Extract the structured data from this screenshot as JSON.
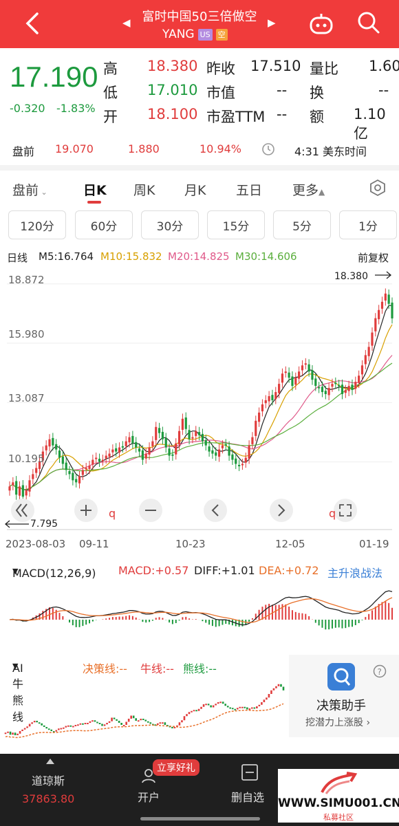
{
  "header": {
    "title": "富时中国50三倍做空",
    "symbol": "YANG",
    "badge_us": "US",
    "badge_short": "空"
  },
  "quote": {
    "price": "17.190",
    "change": "-0.320",
    "change_pct": "-1.83%",
    "high_label": "高",
    "high": "18.380",
    "low_label": "低",
    "low": "17.010",
    "open_label": "开",
    "open": "18.100",
    "prev_close_label": "昨收",
    "prev_close": "17.510",
    "mcap_label": "市值",
    "mcap": "--",
    "pe_label": "市盈TTM",
    "pe": "--",
    "vol_ratio_label": "量比",
    "vol_ratio": "1.60",
    "turnover_label": "换",
    "turnover": "--",
    "amount_label": "额",
    "amount": "1.10亿"
  },
  "premarket": {
    "label": "盘前",
    "price": "19.070",
    "change": "1.880",
    "change_pct": "10.94%",
    "time": "4:31 美东时间"
  },
  "tabs": {
    "premarket": "盘前",
    "day": "日K",
    "week": "周K",
    "month": "月K",
    "five_day": "五日",
    "more": "更多"
  },
  "periods": [
    "120分",
    "60分",
    "30分",
    "15分",
    "5分",
    "1分"
  ],
  "ma": {
    "type": "日线",
    "m5": "M5:16.764",
    "m10": "M10:15.832",
    "m20": "M20:14.825",
    "m30": "M30:14.606",
    "adjust": "前复权"
  },
  "chart_data": {
    "type": "candlestick",
    "title": "",
    "y_ticks": [
      "18.872",
      "15.980",
      "13.087",
      "10.195"
    ],
    "x_ticks": [
      "2023-08-03",
      "09-11",
      "10-23",
      "12-05",
      "01-19"
    ],
    "ylim": [
      7.3,
      19.3
    ],
    "high_marker": "18.380",
    "low_marker": "7.795",
    "closes": [
      9.0,
      9.2,
      8.6,
      9.0,
      8.5,
      8.8,
      9.3,
      9.6,
      9.9,
      10.2,
      10.7,
      11.0,
      11.3,
      11.0,
      10.8,
      10.4,
      10.1,
      9.8,
      9.6,
      9.3,
      9.2,
      9.5,
      9.8,
      9.9,
      10.0,
      10.3,
      10.4,
      10.2,
      10.3,
      10.5,
      10.6,
      10.8,
      10.7,
      10.9,
      10.9,
      11.2,
      11.4,
      11.1,
      10.9,
      10.7,
      10.3,
      10.6,
      10.9,
      11.2,
      11.9,
      11.6,
      11.3,
      10.9,
      10.5,
      10.5,
      11.1,
      11.7,
      12.3,
      11.8,
      11.3,
      11.4,
      11.7,
      11.5,
      11.2,
      11.0,
      10.7,
      10.6,
      10.5,
      10.8,
      11.0,
      11.0,
      10.5,
      10.3,
      10.1,
      10.0,
      10.1,
      10.4,
      11.0,
      11.4,
      12.2,
      12.6,
      13.0,
      13.2,
      13.4,
      13.2,
      13.6,
      14.0,
      14.5,
      14.6,
      14.3,
      13.9,
      14.3,
      14.6,
      14.9,
      15.0,
      14.6,
      14.2,
      13.9,
      13.8,
      13.6,
      13.5,
      13.8,
      14.0,
      14.0,
      13.9,
      13.5,
      13.7,
      13.9,
      13.7,
      14.1,
      14.4,
      14.9,
      15.4,
      15.8,
      16.5,
      17.2,
      17.6,
      18.0,
      18.4,
      17.9,
      17.19
    ]
  },
  "macd": {
    "label": "MACD(12,26,9)",
    "macd": "MACD:+0.57",
    "diff": "DIFF:+1.01",
    "dea": "DEA:+0.72",
    "link": "主升浪战法"
  },
  "ai": {
    "label": "AI牛熊线",
    "decision": "决策线:--",
    "bull": "牛线:--",
    "bear": "熊线:--"
  },
  "assistant": {
    "title": "决策助手",
    "sub": "挖潜力上涨股"
  },
  "nav": {
    "index_name": "道琼斯",
    "index_value": "37863.80",
    "open_account": "开户",
    "promo": "立享好礼",
    "delete": "删自选"
  },
  "watermark": {
    "site": "WWW.SIMU001.CN",
    "sub": "私募社区"
  },
  "colors": {
    "up": "#e03c3c",
    "down": "#1d9a3e",
    "header": "#f03b3b"
  }
}
